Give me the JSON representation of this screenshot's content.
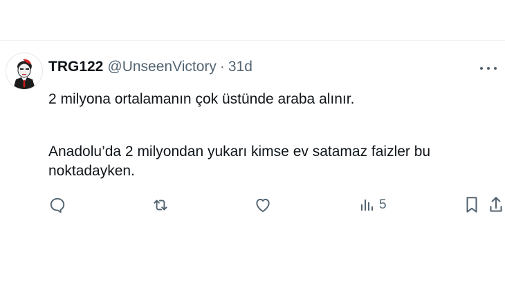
{
  "tweet": {
    "display_name": "TRG122",
    "handle": "@UnseenVictory",
    "separator": "·",
    "time": "31d",
    "paragraphs": [
      "2 milyona ortalamanın çok üstünde araba alınır.",
      "Anadolu’da 2 milyondan yukarı kimse ev satamaz faizler bu noktadayken."
    ]
  },
  "actions": {
    "views_count": "5"
  },
  "icons": {
    "avatar": "avatar-portrait",
    "more": "more-horizontal-icon",
    "reply": "reply-icon",
    "retweet": "retweet-icon",
    "like": "heart-icon",
    "views": "views-bar-chart-icon",
    "bookmark": "bookmark-icon",
    "share": "share-icon"
  },
  "colors": {
    "text_primary": "#0f1419",
    "text_secondary": "#536471",
    "divider": "#eff3f4"
  }
}
